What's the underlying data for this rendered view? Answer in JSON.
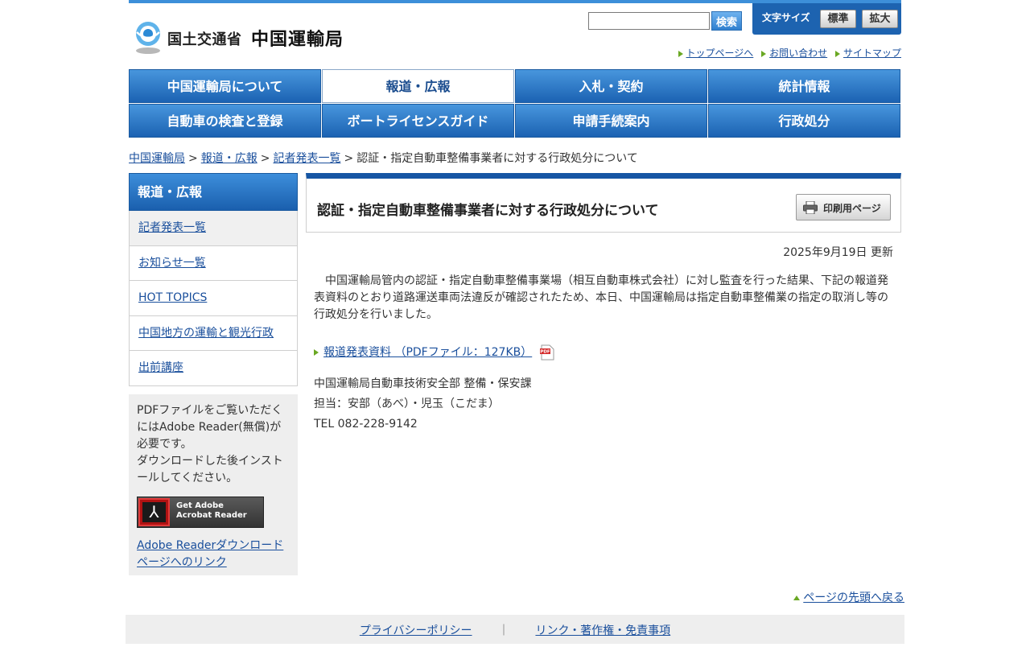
{
  "header": {
    "ministry": "国土交通省",
    "bureau": "中国運輸局",
    "search_button": "検索",
    "fontsize_label": "文字サイズ",
    "fontsize_standard": "標準",
    "fontsize_large": "拡大",
    "util_links": [
      "トップページへ",
      "お問い合わせ",
      "サイトマップ"
    ]
  },
  "gnav": {
    "row1": [
      "中国運輸局について",
      "報道・広報",
      "入札・契約",
      "統計情報"
    ],
    "row2": [
      "自動車の検査と登録",
      "ボートライセンスガイド",
      "申請手続案内",
      "行政処分"
    ],
    "active": "報道・広報"
  },
  "breadcrumb": {
    "items": [
      "中国運輸局",
      "報道・広報",
      "記者発表一覧"
    ],
    "current": "認証・指定自動車整備事業者に対する行政処分について",
    "separator": ">"
  },
  "sidebar": {
    "heading": "報道・広報",
    "items": [
      "記者発表一覧",
      "お知らせ一覧",
      "HOT TOPICS",
      "中国地方の運輸と観光行政",
      "出前講座"
    ],
    "pdf_note_1": "PDFファイルをご覧いただくにはAdobe Reader(無償)が必要です。",
    "pdf_note_2": "ダウンロードした後インストールしてください。",
    "adobe_badge_line1": "Get Adobe",
    "adobe_badge_line2": "Acrobat Reader",
    "adobe_link": "Adobe Readerダウンロードページへのリンク"
  },
  "main": {
    "title": "認証・指定自動車整備事業者に対する行政処分について",
    "print_button": "印刷用ページ",
    "updated": "2025年9月19日 更新",
    "body": "中国運輸局管内の認証・指定自動車整備事業場（相互自動車株式会社）に対し監査を行った結果、下記の報道発表資料のとおり道路運送車両法違反が確認されたため、本日、中国運輸局は指定自動車整備業の指定の取消し等の行政処分を行いました。",
    "pdf_link": "報道発表資料 （PDFファイル：127KB）",
    "contact_lines": [
      "中国運輸局自動車技術安全部 整備・保安課",
      "担当：安部（あべ）・児玉（こだま）",
      "TEL 082-228-9142"
    ]
  },
  "pagetop": "ページの先頭へ戻る",
  "footer": {
    "links": [
      "プライバシーポリシー",
      "リンク・著作権・免責事項"
    ],
    "separator": "｜"
  }
}
